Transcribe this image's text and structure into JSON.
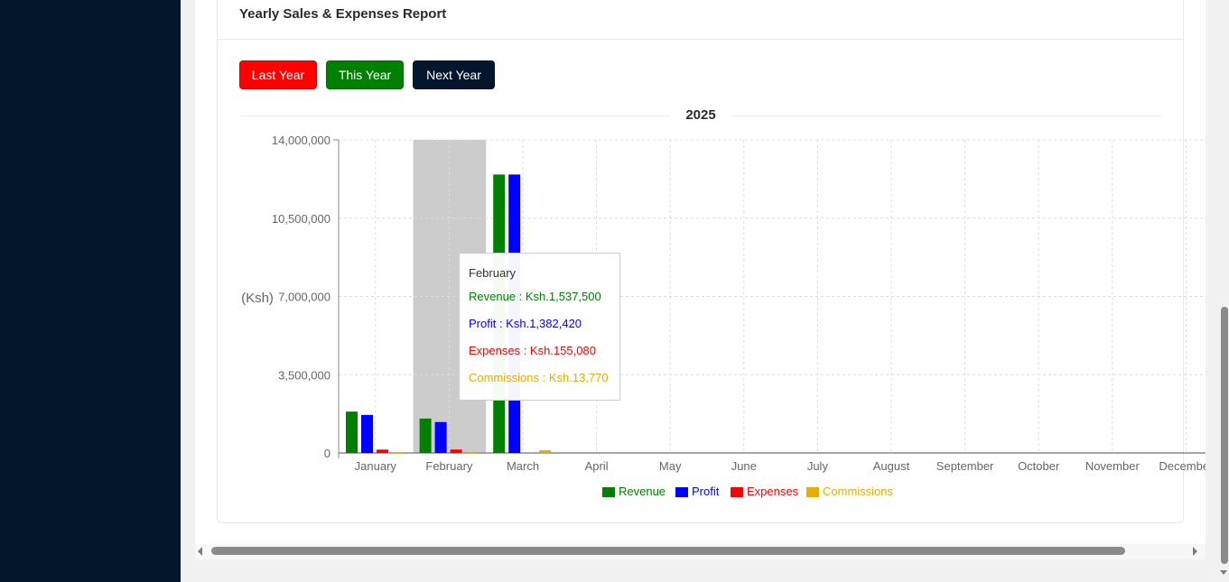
{
  "report": {
    "title": "Yearly Sales & Expenses Report",
    "buttons": {
      "last_year": "Last Year",
      "this_year": "This Year",
      "next_year": "Next Year"
    },
    "button_colors": {
      "last_year": "#ff0000",
      "this_year": "#008000",
      "next_year": "#03162b"
    },
    "year": "2025"
  },
  "tooltip": {
    "month": "February",
    "revenue": "Revenue : Ksh.1,537,500",
    "profit": "Profit : Ksh.1,382,420",
    "expenses": "Expenses : Ksh.155,080",
    "commissions": "Commissions : Ksh.13,770"
  },
  "chart_data": {
    "type": "bar",
    "categories": [
      "January",
      "February",
      "March",
      "April",
      "May",
      "June",
      "July",
      "August",
      "September",
      "October",
      "November",
      "December"
    ],
    "series": [
      {
        "name": "Revenue",
        "color": "#008000",
        "values": [
          1850000,
          1537500,
          12450000,
          0,
          0,
          0,
          0,
          0,
          0,
          0,
          0,
          0
        ]
      },
      {
        "name": "Profit",
        "color": "#0000ff",
        "values": [
          1700000,
          1382420,
          12450000,
          0,
          0,
          0,
          0,
          0,
          0,
          0,
          0,
          0
        ]
      },
      {
        "name": "Expenses",
        "color": "#ff0000",
        "values": [
          150000,
          155080,
          0,
          0,
          0,
          0,
          0,
          0,
          0,
          0,
          0,
          0
        ]
      },
      {
        "name": "Commissions",
        "color": "#e6ac00",
        "values": [
          10000,
          13770,
          120000,
          0,
          0,
          0,
          0,
          0,
          0,
          0,
          0,
          0
        ]
      }
    ],
    "ylabel": "(Ksh)",
    "ylim": [
      0,
      14000000
    ],
    "yticks": [
      0,
      3500000,
      7000000,
      10500000,
      14000000
    ],
    "ytick_labels": [
      "0",
      "3,500,000",
      "7,000,000",
      "10,500,000",
      "14,000,000"
    ],
    "grid": true,
    "legend_position": "bottom",
    "highlighted_category": "February"
  }
}
